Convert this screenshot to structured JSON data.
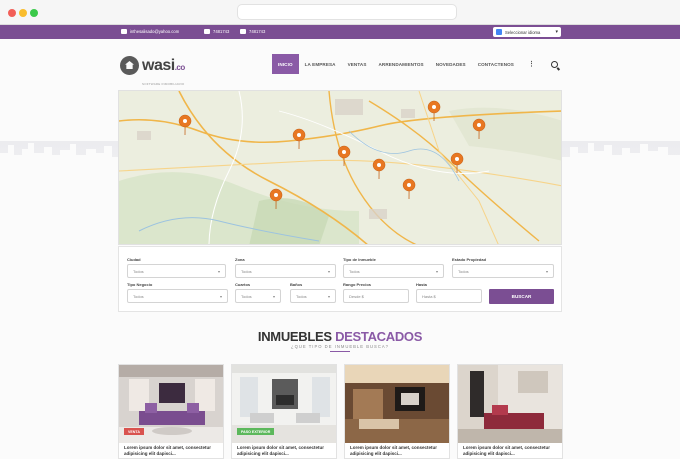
{
  "topbar": {
    "email": "inthesalisado@yahoo.com",
    "phone1": "7481743",
    "phone2": "7481743",
    "language": "Seleccionar idioma"
  },
  "header": {
    "logo_text": "wasi",
    "logo_suffix": ".co",
    "logo_tagline": "SOFTWARE INMOBILIARIO",
    "nav": [
      "INICIO",
      "LA EMPRESA",
      "VENTAS",
      "ARRENDAMIENTOS",
      "NOVEDADES",
      "CONTACTENOS"
    ],
    "more": "⋮"
  },
  "search_form": {
    "labels": {
      "ciudad": "Ciudad",
      "zona": "Zona",
      "tipo_inmueble": "Tipo de Inmueble",
      "estado": "Estado Propiedad",
      "tipo_negocio": "Tipo Negocio",
      "cuartos": "Cuartos",
      "banos": "Baños",
      "rango": "Rango Precios",
      "hasta": "Hasta"
    },
    "values": {
      "ciudad": "Todos",
      "zona": "Todos",
      "tipo_inmueble": "Todos",
      "estado": "Todos",
      "tipo_negocio": "Todos",
      "cuartos": "Todos",
      "banos": "Todos"
    },
    "placeholders": {
      "desde": "Desde $",
      "hasta": "Hasta $"
    },
    "button": "BUSCAR"
  },
  "featured": {
    "title_a": "INMUEBLES",
    "title_b": "DESTACADOS",
    "subtitle": "¿QUE TIPO DE INMUEBLE BUSCA?"
  },
  "cards": [
    {
      "badge": "VENTA",
      "badge_color": "#d9534f",
      "desc": "Lorem ipsum dolor sit amet, consectetur adipisicing elit dapisci..."
    },
    {
      "badge": "PASO EXTERIOR",
      "badge_color": "#5cb85c",
      "desc": "Lorem ipsum dolor sit amet, consectetur adipisicing elit dapisci..."
    },
    {
      "badge": "",
      "badge_color": "",
      "desc": "Lorem ipsum dolor sit amet, consectetur adipisicing elit dapisci..."
    },
    {
      "badge": "",
      "badge_color": "",
      "desc": "Lorem ipsum dolor sit amet, consectetur adipisicing elit dapisci..."
    }
  ],
  "colors": {
    "brand_purple": "#7b4e93",
    "marker_orange": "#e87722"
  }
}
